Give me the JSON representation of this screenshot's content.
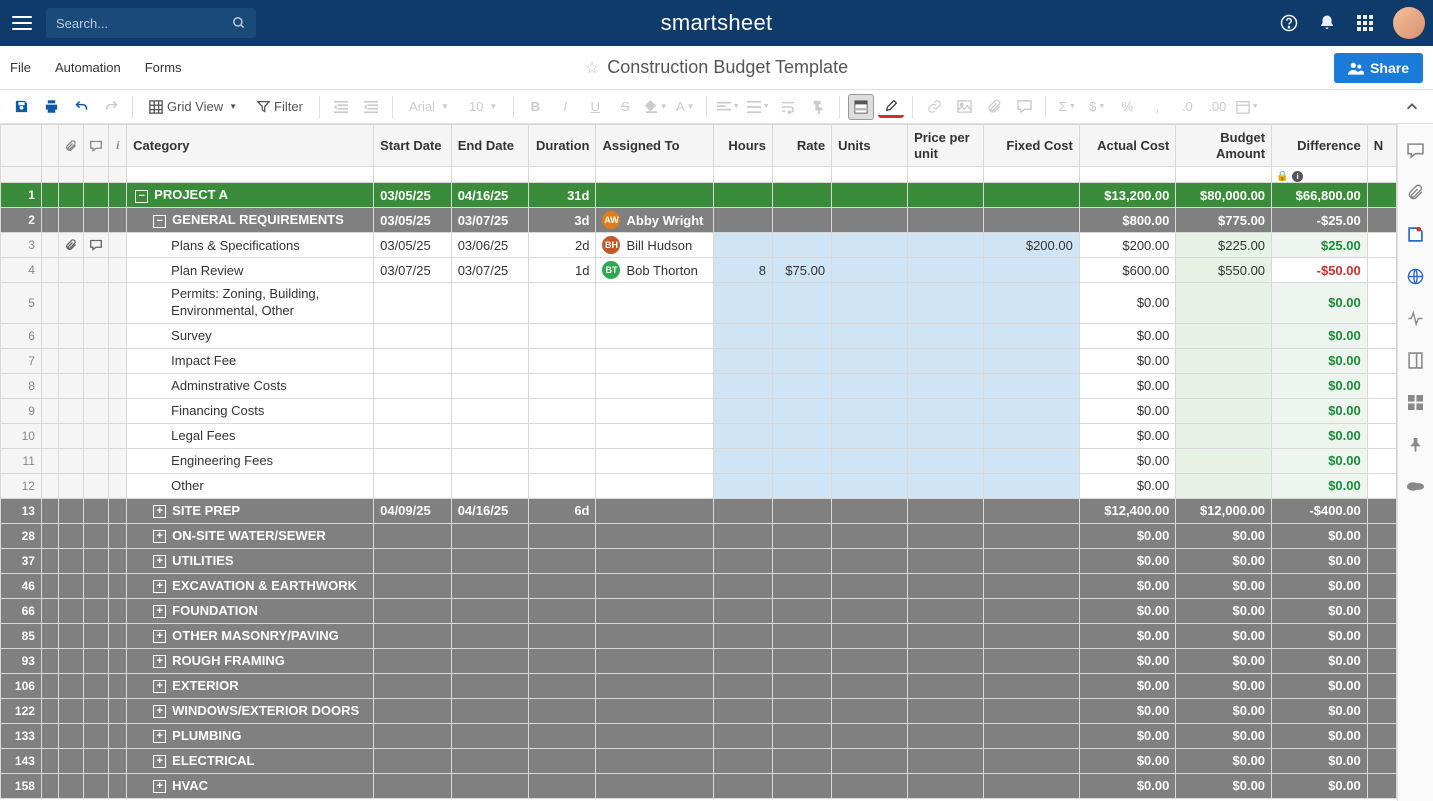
{
  "top": {
    "search_placeholder": "Search...",
    "brand": "smartsheet"
  },
  "menu": {
    "file": "File",
    "automation": "Automation",
    "forms": "Forms",
    "title": "Construction Budget Template",
    "share": "Share"
  },
  "toolbar": {
    "view": "Grid View",
    "filter": "Filter",
    "font": "Arial",
    "size": "10"
  },
  "columns": {
    "category": "Category",
    "start": "Start Date",
    "end": "End Date",
    "duration": "Duration",
    "assigned": "Assigned To",
    "hours": "Hours",
    "rate": "Rate",
    "units": "Units",
    "ppu": "Price per unit",
    "fixed": "Fixed Cost",
    "actual": "Actual Cost",
    "budget": "Budget Amount",
    "diff": "Difference",
    "notes": "N"
  },
  "rows": [
    {
      "num": "1",
      "type": "project",
      "indent": 0,
      "exp": "-",
      "cat": "PROJECT A",
      "start": "03/05/25",
      "end": "04/16/25",
      "dur": "31d",
      "assigned": "",
      "hours": "",
      "rate": "",
      "units": "",
      "ppu": "",
      "fixed": "",
      "actual": "$13,200.00",
      "budget": "$80,000.00",
      "diff": "$66,800.00",
      "diffClass": "green-on-green"
    },
    {
      "num": "2",
      "type": "section",
      "indent": 1,
      "exp": "-",
      "cat": "GENERAL REQUIREMENTS",
      "start": "03/05/25",
      "end": "03/07/25",
      "dur": "3d",
      "assigned": "Abby Wright",
      "av": "av-aw",
      "avt": "AW",
      "actual": "$800.00",
      "budget": "$775.00",
      "diff": "-$25.00",
      "diffClass": "red-gray"
    },
    {
      "num": "3",
      "type": "detail",
      "indent": 2,
      "cat": "Plans & Specifications",
      "start": "03/05/25",
      "end": "03/06/25",
      "dur": "2d",
      "assigned": "Bill Hudson",
      "av": "av-bh",
      "avt": "BH",
      "fixed": "$200.00",
      "actual": "$200.00",
      "budget": "$225.00",
      "diff": "$25.00",
      "diffClass": "green",
      "attach": true,
      "comment": true
    },
    {
      "num": "4",
      "type": "detail",
      "indent": 2,
      "cat": "Plan Review",
      "start": "03/07/25",
      "end": "03/07/25",
      "dur": "1d",
      "assigned": "Bob Thorton",
      "av": "av-bt",
      "avt": "BT",
      "hours": "8",
      "rate": "$75.00",
      "actual": "$600.00",
      "budget": "$550.00",
      "diff": "-$50.00",
      "diffClass": "red"
    },
    {
      "num": "5",
      "type": "detail",
      "indent": 2,
      "cat": "Permits: Zoning, Building, Environmental, Other",
      "actual": "$0.00",
      "diff": "$0.00",
      "diffClass": "green",
      "tall": true
    },
    {
      "num": "6",
      "type": "detail",
      "indent": 2,
      "cat": "Survey",
      "actual": "$0.00",
      "diff": "$0.00",
      "diffClass": "green"
    },
    {
      "num": "7",
      "type": "detail",
      "indent": 2,
      "cat": "Impact Fee",
      "actual": "$0.00",
      "diff": "$0.00",
      "diffClass": "green"
    },
    {
      "num": "8",
      "type": "detail",
      "indent": 2,
      "cat": "Adminstrative Costs",
      "actual": "$0.00",
      "diff": "$0.00",
      "diffClass": "green"
    },
    {
      "num": "9",
      "type": "detail",
      "indent": 2,
      "cat": "Financing Costs",
      "actual": "$0.00",
      "diff": "$0.00",
      "diffClass": "green"
    },
    {
      "num": "10",
      "type": "detail",
      "indent": 2,
      "cat": "Legal Fees",
      "actual": "$0.00",
      "diff": "$0.00",
      "diffClass": "green"
    },
    {
      "num": "11",
      "type": "detail",
      "indent": 2,
      "cat": "Engineering Fees",
      "actual": "$0.00",
      "diff": "$0.00",
      "diffClass": "green"
    },
    {
      "num": "12",
      "type": "detail",
      "indent": 2,
      "cat": "Other",
      "actual": "$0.00",
      "diff": "$0.00",
      "diffClass": "green"
    },
    {
      "num": "13",
      "type": "section",
      "indent": 1,
      "exp": "+",
      "cat": "SITE PREP",
      "start": "04/09/25",
      "end": "04/16/25",
      "dur": "6d",
      "actual": "$12,400.00",
      "budget": "$12,000.00",
      "diff": "-$400.00",
      "diffClass": "red-gray"
    },
    {
      "num": "28",
      "type": "section",
      "indent": 1,
      "exp": "+",
      "cat": "ON-SITE WATER/SEWER",
      "actual": "$0.00",
      "budget": "$0.00",
      "diff": "$0.00",
      "diffClass": "green-gray"
    },
    {
      "num": "37",
      "type": "section",
      "indent": 1,
      "exp": "+",
      "cat": "UTILITIES",
      "actual": "$0.00",
      "budget": "$0.00",
      "diff": "$0.00",
      "diffClass": "green-gray"
    },
    {
      "num": "46",
      "type": "section",
      "indent": 1,
      "exp": "+",
      "cat": "EXCAVATION & EARTHWORK",
      "actual": "$0.00",
      "budget": "$0.00",
      "diff": "$0.00",
      "diffClass": "green-gray"
    },
    {
      "num": "66",
      "type": "section",
      "indent": 1,
      "exp": "+",
      "cat": "FOUNDATION",
      "actual": "$0.00",
      "budget": "$0.00",
      "diff": "$0.00",
      "diffClass": "green-gray"
    },
    {
      "num": "85",
      "type": "section",
      "indent": 1,
      "exp": "+",
      "cat": "OTHER MASONRY/PAVING",
      "actual": "$0.00",
      "budget": "$0.00",
      "diff": "$0.00",
      "diffClass": "green-gray"
    },
    {
      "num": "93",
      "type": "section",
      "indent": 1,
      "exp": "+",
      "cat": "ROUGH FRAMING",
      "actual": "$0.00",
      "budget": "$0.00",
      "diff": "$0.00",
      "diffClass": "green-gray"
    },
    {
      "num": "106",
      "type": "section",
      "indent": 1,
      "exp": "+",
      "cat": "EXTERIOR",
      "actual": "$0.00",
      "budget": "$0.00",
      "diff": "$0.00",
      "diffClass": "green-gray"
    },
    {
      "num": "122",
      "type": "section",
      "indent": 1,
      "exp": "+",
      "cat": "WINDOWS/EXTERIOR DOORS",
      "actual": "$0.00",
      "budget": "$0.00",
      "diff": "$0.00",
      "diffClass": "green-gray"
    },
    {
      "num": "133",
      "type": "section",
      "indent": 1,
      "exp": "+",
      "cat": "PLUMBING",
      "actual": "$0.00",
      "budget": "$0.00",
      "diff": "$0.00",
      "diffClass": "green-gray"
    },
    {
      "num": "143",
      "type": "section",
      "indent": 1,
      "exp": "+",
      "cat": "ELECTRICAL",
      "actual": "$0.00",
      "budget": "$0.00",
      "diff": "$0.00",
      "diffClass": "green-gray"
    },
    {
      "num": "158",
      "type": "section",
      "indent": 1,
      "exp": "+",
      "cat": "HVAC",
      "actual": "$0.00",
      "budget": "$0.00",
      "diff": "$0.00",
      "diffClass": "green-gray"
    }
  ]
}
